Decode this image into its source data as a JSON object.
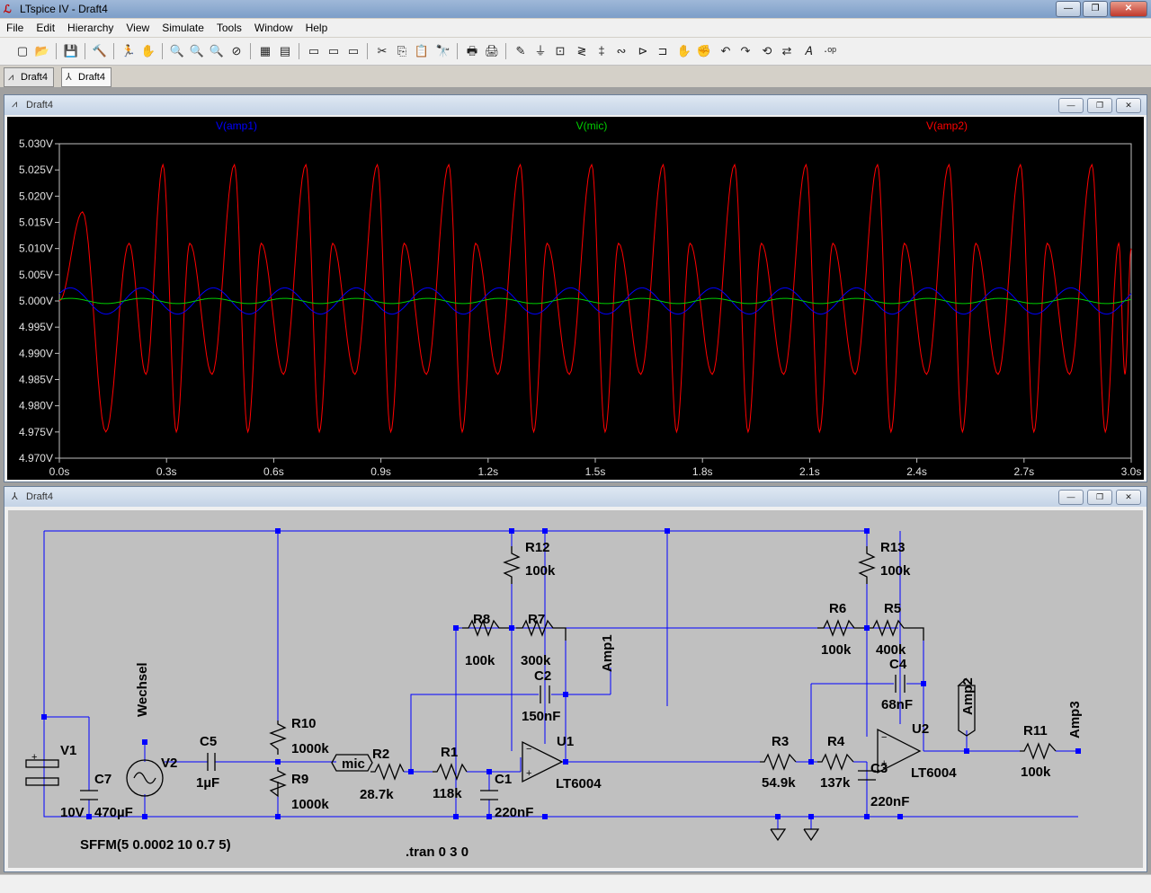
{
  "window": {
    "title": "LTspice IV - Draft4",
    "buttons": {
      "minimize": "—",
      "maximize": "❐",
      "close": "✕"
    }
  },
  "menu": [
    "File",
    "Edit",
    "Hierarchy",
    "View",
    "Simulate",
    "Tools",
    "Window",
    "Help"
  ],
  "toolbar": [
    "new-schematic",
    "open",
    "save",
    "control-panel",
    "run",
    "halt",
    "zoom-in",
    "zoom-pan",
    "zoom-out",
    "zoom-cancel",
    "autorange",
    "reset-axes",
    "tile-vertical",
    "tile-horizontal",
    "cascade",
    "cut",
    "copy",
    "paste",
    "find",
    "print-setup",
    "print",
    "wire",
    "ground",
    "label-net",
    "resistor",
    "capacitor",
    "inductor",
    "diode",
    "component",
    "move",
    "drag",
    "undo",
    "redo",
    "rotate",
    "mirror",
    "text",
    "spice-directive"
  ],
  "tabs": [
    {
      "label": "Draft4",
      "icon": "waveform-icon"
    },
    {
      "label": "Draft4",
      "icon": "schematic-icon"
    }
  ],
  "waveform_window": {
    "title": "Draft4",
    "chart_data": {
      "type": "line",
      "legend": [
        "V(amp1)",
        "V(mic)",
        "V(amp2)"
      ],
      "colors": {
        "V(amp1)": "#0000ff",
        "V(mic)": "#00d000",
        "V(amp2)": "#ff0000"
      },
      "y_ticks": [
        "5.030V",
        "5.025V",
        "5.020V",
        "5.015V",
        "5.010V",
        "5.005V",
        "5.000V",
        "4.995V",
        "4.990V",
        "4.985V",
        "4.980V",
        "4.975V",
        "4.970V"
      ],
      "x_ticks": [
        "0.0s",
        "0.3s",
        "0.6s",
        "0.9s",
        "1.2s",
        "1.5s",
        "1.8s",
        "2.1s",
        "2.4s",
        "2.7s",
        "3.0s"
      ],
      "xlim": [
        0,
        3.0
      ],
      "ylim": [
        4.97,
        5.03
      ],
      "series": [
        {
          "name": "V(amp2)",
          "peak_times": [
            0.065,
            0.195,
            0.29,
            0.365,
            0.49,
            0.565,
            0.69,
            0.765,
            0.89,
            0.965,
            1.09,
            1.165,
            1.29,
            1.365,
            1.49,
            1.565,
            1.69,
            1.765,
            1.89,
            1.965,
            2.09,
            2.165,
            2.29,
            2.365,
            2.49,
            2.565,
            2.69,
            2.765,
            2.89,
            2.965
          ],
          "peak_values": [
            5.017,
            5.011,
            5.026,
            5.011,
            5.026,
            5.011,
            5.026,
            5.011,
            5.026,
            5.011,
            5.026,
            5.011,
            5.026,
            5.011,
            5.026,
            5.011,
            5.026,
            5.011,
            5.026,
            5.011,
            5.026,
            5.011,
            5.026,
            5.011,
            5.026,
            5.011,
            5.026,
            5.011,
            5.026,
            5.011
          ],
          "trough_values": [
            4.975,
            4.986,
            4.975,
            4.986,
            4.975,
            4.986,
            4.975,
            4.986,
            4.975,
            4.986,
            4.975,
            4.986,
            4.975,
            4.986,
            4.975,
            4.986,
            4.975,
            4.986,
            4.975,
            4.986,
            4.975,
            4.986,
            4.975,
            4.986,
            4.975,
            4.986,
            4.975,
            4.986,
            4.975,
            4.986
          ]
        },
        {
          "name": "V(amp1)",
          "amplitude": 0.0025,
          "offset": 5.0
        },
        {
          "name": "V(mic)",
          "amplitude": 0.0005,
          "offset": 5.0
        }
      ]
    }
  },
  "schematic_window": {
    "title": "Draft4",
    "labels": {
      "r12": "R12",
      "r12v": "100k",
      "r13": "R13",
      "r13v": "100k",
      "r8": "R8",
      "r8v": "100k",
      "r7": "R7",
      "r7v": "300k",
      "r6": "R6",
      "r6v": "100k",
      "r5": "R5",
      "r5v": "400k",
      "c2": "C2",
      "c2v": "150nF",
      "c4": "C4",
      "c4v": "68nF",
      "amp1": "Amp1",
      "amp2": "Amp2",
      "amp3": "Amp3",
      "wechsel": "Wechsel",
      "r10": "R10",
      "r10v": "1000k",
      "r9": "R9",
      "r9v": "1000k",
      "mic": "mic",
      "r2": "R2",
      "r2v": "28.7k",
      "r1": "R1",
      "r1v": "118k",
      "c1": "C1",
      "c1v": "220nF",
      "u1": "U1",
      "u1v": "LT6004",
      "u2": "U2",
      "u2v": "LT6004",
      "r3": "R3",
      "r3v": "54.9k",
      "r4": "R4",
      "r4v": "137k",
      "c3": "C3",
      "c3v": "220nF",
      "r11": "R11",
      "r11v": "100k",
      "v1": "V1",
      "v1v": "10V",
      "c7": "C7",
      "c7v": "470µF",
      "v2": "V2",
      "c5": "C5",
      "c5v": "1µF",
      "sffm": "SFFM(5 0.0002 10 0.7 5)",
      "tran": ".tran 0 3 0"
    }
  }
}
